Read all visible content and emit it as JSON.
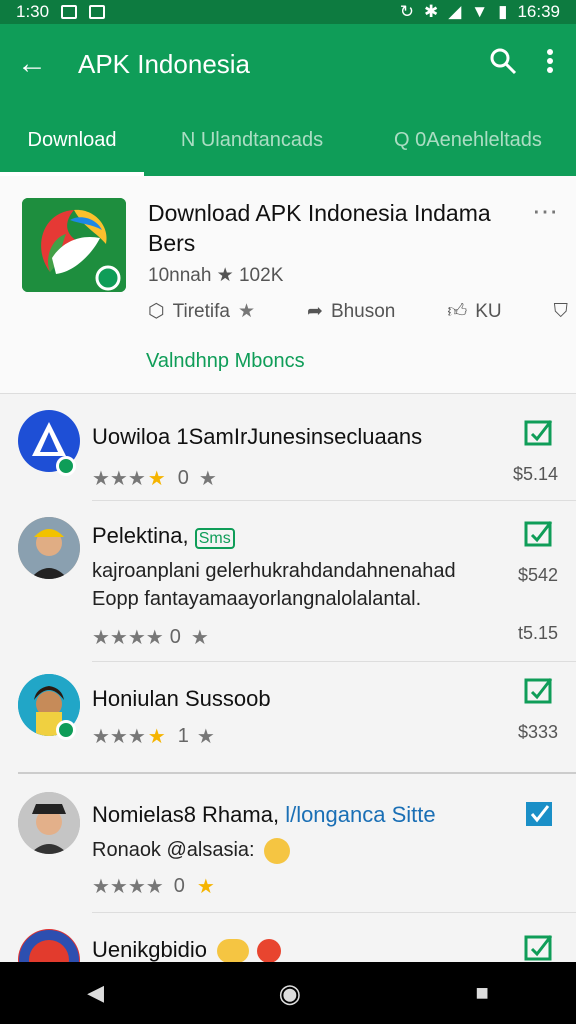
{
  "status": {
    "time": "16:39",
    "left": "1:30"
  },
  "appbar": {
    "title": "APK Indonesia"
  },
  "tabs": [
    {
      "label": "Download"
    },
    {
      "label": "N Ulandtancads"
    },
    {
      "label": "Q 0Aenehleltads"
    }
  ],
  "card": {
    "title": "Download APK Indonesia Indama Bers",
    "rating": "10nnah ★ 102K",
    "action1": "Tiretifa",
    "action2": "Bhuson",
    "action3": "KU",
    "link": "Valndhnp Mboncs"
  },
  "items": [
    {
      "name": "Uowiloa 1SamIrJunesinsecluaans",
      "desc": "",
      "stars_text": "0",
      "price": "$5.14"
    },
    {
      "name": "Pelektina, ",
      "tag": "Sms",
      "desc": "kajroanplani gelerhukrahdandahnenahad Eopp fantayamaayorlangnalolalantal.",
      "stars_text": "0",
      "price": "$542",
      "price2": "t5.15"
    },
    {
      "name": "Honiulan Sussoob",
      "desc": "",
      "stars_text": "1",
      "price": "$333"
    },
    {
      "name": "Nomielas8 Rhama, ",
      "tag": "l/longanca Sitte",
      "desc": "Ronaok @alsasia:",
      "stars_text": "0",
      "price": ""
    },
    {
      "name": "Uenikgbidio",
      "desc": "",
      "stars_text": "",
      "price": ""
    }
  ],
  "colors": {
    "primary": "#0f9d58",
    "dark": "#0d7b40"
  },
  "nav": {
    "back": "◀",
    "home": "◉",
    "recent": "■"
  }
}
